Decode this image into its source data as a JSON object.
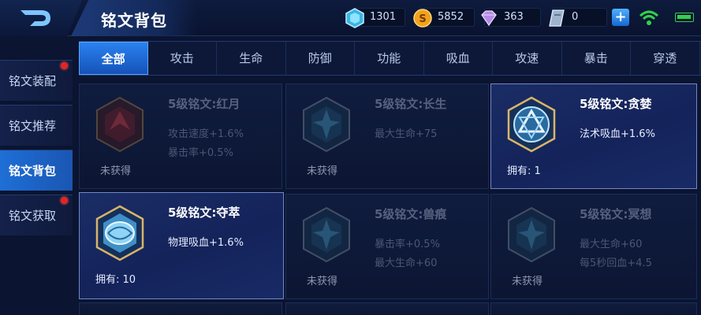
{
  "header": {
    "title": "铭文背包"
  },
  "currencies": [
    {
      "icon": "blue-crystal-icon",
      "value": "1301"
    },
    {
      "icon": "gold-coin-icon",
      "value": "5852"
    },
    {
      "icon": "purple-diamond-icon",
      "value": "363"
    },
    {
      "icon": "inscription-fragment-icon",
      "value": "0"
    }
  ],
  "sidebar": {
    "items": [
      {
        "label": "铭文装配",
        "badge": true
      },
      {
        "label": "铭文推荐",
        "badge": false
      },
      {
        "label": "铭文背包",
        "badge": false,
        "active": true
      },
      {
        "label": "铭文获取",
        "badge": true
      }
    ]
  },
  "tabs": [
    "全部",
    "攻击",
    "生命",
    "防御",
    "功能",
    "吸血",
    "攻速",
    "暴击",
    "穿透"
  ],
  "cards": [
    {
      "name": "5级铭文:红月",
      "stats": [
        "攻击速度+1.6%",
        "暴击率+0.5%"
      ],
      "status": "未获得",
      "owned": false,
      "color": "red"
    },
    {
      "name": "5级铭文:长生",
      "stats": [
        "最大生命+75"
      ],
      "status": "未获得",
      "owned": false,
      "color": "blue"
    },
    {
      "name": "5级铭文:贪婪",
      "stats": [
        "法术吸血+1.6%"
      ],
      "status": "拥有: 1",
      "owned": true,
      "color": "blue"
    },
    {
      "name": "5级铭文:夺萃",
      "stats": [
        "物理吸血+1.6%"
      ],
      "status": "拥有: 10",
      "owned": true,
      "color": "blue"
    },
    {
      "name": "5级铭文:兽痕",
      "stats": [
        "暴击率+0.5%",
        "最大生命+60"
      ],
      "status": "未获得",
      "owned": false,
      "color": "blue"
    },
    {
      "name": "5级铭文:冥想",
      "stats": [
        "最大生命+60",
        "每5秒回血+4.5"
      ],
      "status": "未获得",
      "owned": false,
      "color": "blue"
    }
  ],
  "colors": {
    "accent": "#1e6fd6",
    "background": "#0b1430",
    "badge": "#e52424"
  }
}
